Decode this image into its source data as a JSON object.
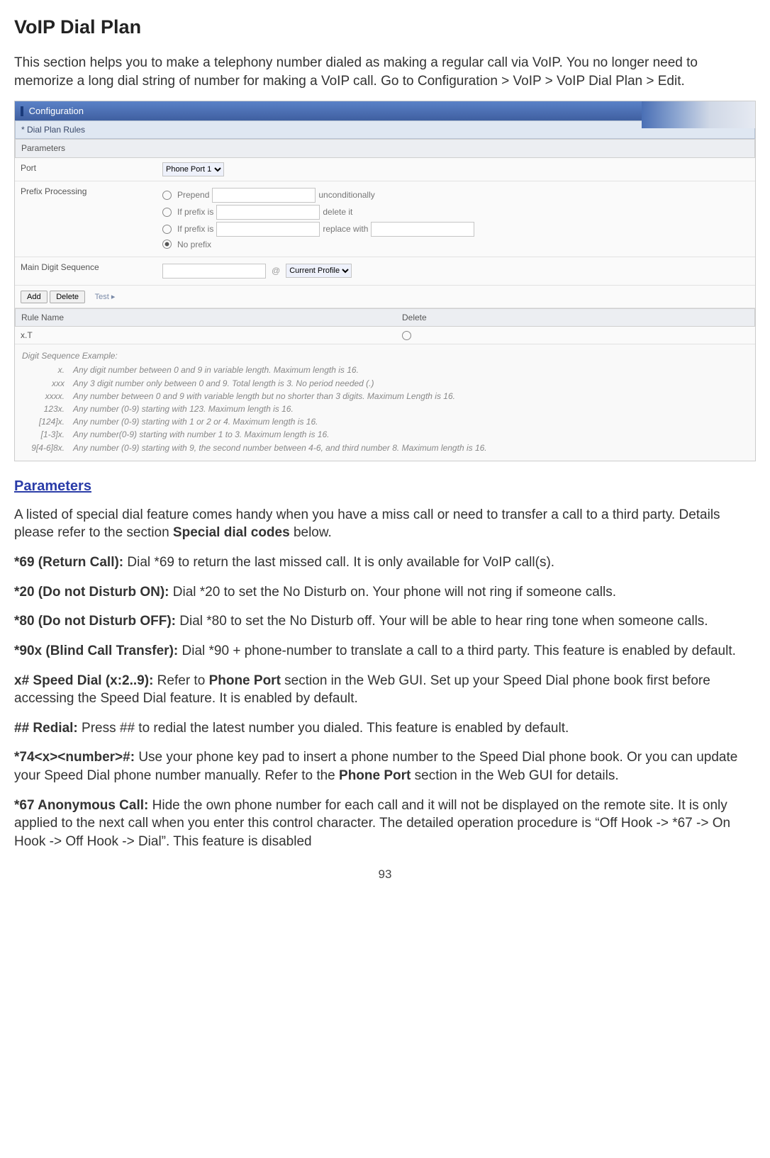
{
  "title": "VoIP Dial Plan",
  "intro": "This section helps you to make a telephony number dialed as making a regular call via VoIP. You no longer need to memorize a long dial string of number for making a VoIP call. Go to Configuration > VoIP > VoIP Dial Plan > Edit.",
  "cfg": {
    "bar": "Configuration",
    "section": "* Dial Plan Rules",
    "panel_params": "Parameters",
    "port_label": "Port",
    "port_value": "Phone Port 1",
    "prefix_label": "Prefix Processing",
    "prepend": "Prepend",
    "prepend_suffix": "unconditionally",
    "ifprefix1": "If prefix is",
    "delete_it": "delete it",
    "ifprefix2": "If prefix is",
    "replace_with": "replace with",
    "noprefix": "No prefix",
    "main_seq_label": "Main Digit Sequence",
    "profile": "Current Profile",
    "add": "Add",
    "delete": "Delete",
    "test": "Test ▸",
    "rule_name_h": "Rule Name",
    "delete_h": "Delete",
    "rule0": "x.T",
    "ex_title": "Digit Sequence Example:",
    "ex": [
      {
        "c": "x.",
        "d": "Any digit number between 0 and 9 in variable length. Maximum length is 16."
      },
      {
        "c": "xxx",
        "d": "Any 3 digit number only between 0 and 9. Total length is 3. No period needed (.)"
      },
      {
        "c": "xxxx.",
        "d": "Any number between 0 and 9 with variable length but no shorter than 3 digits. Maximum Length is 16."
      },
      {
        "c": "123x.",
        "d": "Any number (0-9) starting with 123. Maximum length is 16."
      },
      {
        "c": "[124]x.",
        "d": "Any number (0-9) starting with 1 or 2 or 4. Maximum length is 16."
      },
      {
        "c": "[1-3]x.",
        "d": "Any number(0-9) starting with number 1 to 3. Maximum length is 16."
      },
      {
        "c": "9[4-6]8x.",
        "d": "Any number (0-9) starting with 9, the second number between 4-6, and third number 8. Maximum length is 16."
      }
    ]
  },
  "params_h": "Parameters",
  "params_intro_a": "A listed of special dial feature comes handy when you have a miss call or need to transfer a call to a third party. Details please refer to the section ",
  "params_intro_b": "Special dial codes",
  "params_intro_c": " below.",
  "features": [
    {
      "name": "*69 (Return Call):",
      "desc": " Dial *69 to return the last missed call. It is only available for VoIP call(s)."
    },
    {
      "name": "*20 (Do not Disturb ON):",
      "desc": " Dial *20 to set the No Disturb on. Your phone will not ring if someone calls."
    },
    {
      "name": "*80 (Do not Disturb OFF):",
      "desc": " Dial *80 to set the No Disturb off. Your will be able to hear ring tone when someone calls."
    },
    {
      "name": "*90x (Blind Call Transfer):",
      "desc": " Dial *90 + phone-number to translate a call to a third party. This feature is enabled by default."
    }
  ],
  "speed": {
    "name": "x# Speed Dial (x:2..9):",
    "a": " Refer to ",
    "b": "Phone Port",
    "c": " section in the Web GUI. Set up your Speed Dial phone book first before accessing the Speed Dial feature. It is enabled by default."
  },
  "redial": {
    "name": "## Redial:",
    "desc": " Press ## to redial the latest number you dialed. This feature is enabled by default."
  },
  "ins": {
    "name": "*74<x><number>#:",
    "a": " Use your phone key pad to insert a phone number to the Speed Dial phone book. Or you can update your Speed Dial phone number manually. Refer to the ",
    "b": "Phone Port",
    "c": " section in the Web GUI for details."
  },
  "anon": {
    "name": "*67 Anonymous Call:",
    "desc": " Hide the own phone number for each call and it will not be displayed on the remote site. It is only applied to the next call when you enter this control character. The detailed operation procedure is “Off Hook -> *67 -> On Hook -> Off Hook -> Dial”. This feature is disabled"
  },
  "page": "93"
}
